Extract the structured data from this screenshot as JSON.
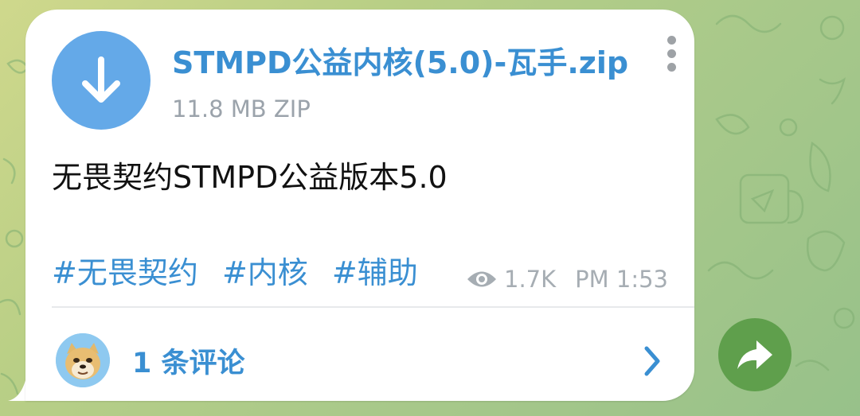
{
  "message": {
    "file": {
      "icon": "download-arrow-icon",
      "name": "STMPD公益内核(5.0)-瓦手.zip",
      "meta": "11.8 MB ZIP"
    },
    "caption": "无畏契约STMPD公益版本5.0",
    "hashtags": [
      "#无畏契约",
      "#内核",
      "#辅助"
    ],
    "views_icon": "eye-icon",
    "views": "1.7K",
    "time": "PM 1:53",
    "menu_icon": "vertical-dots-icon"
  },
  "comments": {
    "avatar_icon": "doge-avatar",
    "label": "1 条评论",
    "chevron_icon": "chevron-right-icon"
  },
  "share_button": {
    "icon": "share-arrow-icon"
  },
  "colors": {
    "accent": "#3a8fd2",
    "file_icon_bg": "#64a9e8",
    "meta_text": "#9ba3ab",
    "share_bg": "#5f9f4c"
  }
}
